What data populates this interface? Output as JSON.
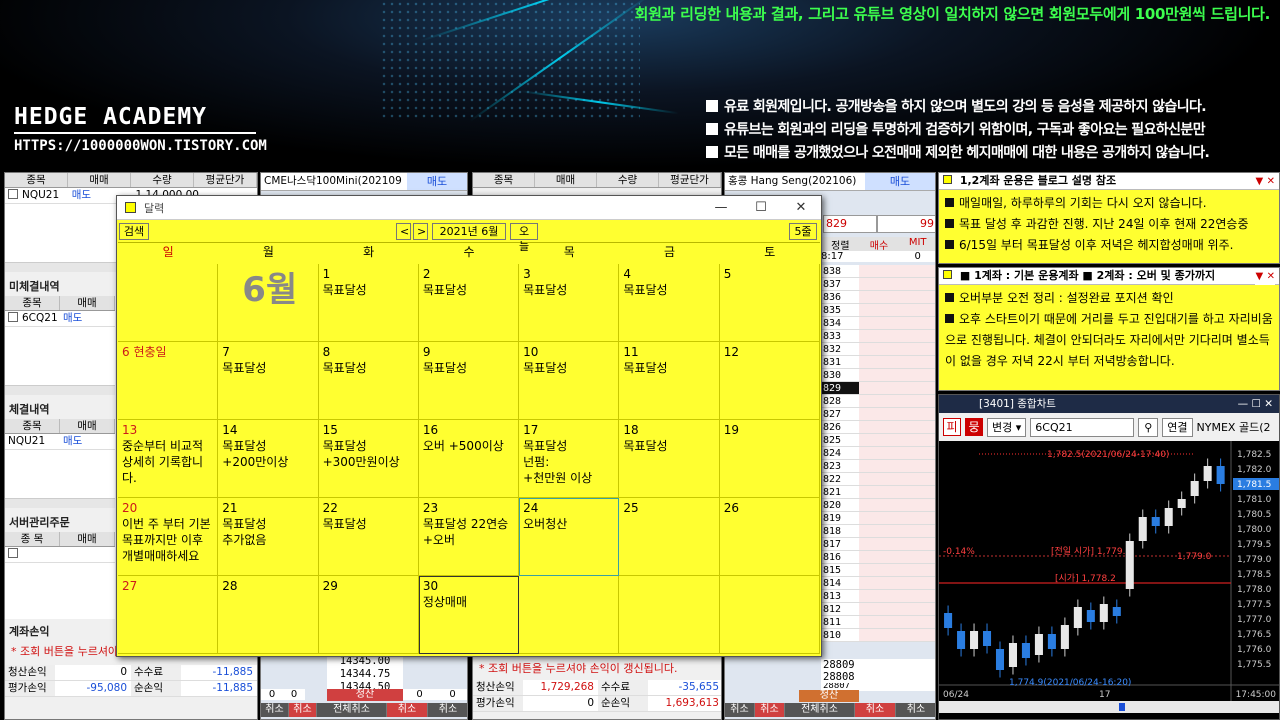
{
  "banner": {
    "top_notice": "회원과 리딩한 내용과 결과, 그리고 유튜브 영상이 일치하지 않으면 회원모두에게 100만원씩 드립니다.",
    "brand": "HEDGE ACADEMY",
    "brand_url": "HTTPS://1000000WON.TISTORY.COM",
    "bullets": [
      "유료 회원제입니다. 공개방송을 하지 않으며 별도의 강의 등 음성을 제공하지 않습니다.",
      "유튜브는 회원과의 리딩을 투명하게 검증하기 위함이며, 구독과 좋아요는 필요하신분만",
      "모든 매매를 공개했었으나 오전매매 제외한 헤지매매에 대한 내용은 공개하지 않습니다."
    ]
  },
  "left_panel": {
    "headers": [
      "종목",
      "매매",
      "수량",
      "평균단가"
    ],
    "row1": {
      "symbol": "NQU21",
      "side": "매도",
      "rest": "1  14,000.00"
    },
    "unfilled_title": "미체결내역",
    "unfilled_headers": [
      "종목",
      "매매"
    ],
    "unfilled_row": {
      "symbol": "6CQ21",
      "side": "매도"
    },
    "filled_title": "체결내역",
    "filled_headers": [
      "종목",
      "매매"
    ],
    "filled_row": {
      "symbol": "NQU21",
      "side": "매도"
    },
    "server_title": "서버관리주문",
    "server_headers": [
      "종 목",
      "매매"
    ],
    "account_title": "계좌손익",
    "account_note": "* 조회 버튼을 누르셔야 손익이 갱신됩니다.",
    "pnl_rows": [
      {
        "label": "청산손익",
        "value": "0",
        "label2": "수수료",
        "value2": "-11,885"
      },
      {
        "label": "평가손익",
        "value": "-95,080",
        "label2": "순손익",
        "value2": "-11,885"
      }
    ]
  },
  "mid_panel": {
    "title": "CME나스닥100Mini(202109",
    "side_label": "매도",
    "prices": [
      "14345.00",
      "14344.75",
      "14344.50"
    ],
    "clear_label": "청산",
    "buttons": [
      "취소",
      "취소",
      "전체취소",
      "취소",
      "취소"
    ],
    "zeros": [
      "0",
      "0",
      "0",
      "0"
    ]
  },
  "right_mid_panel": {
    "headers": [
      "종목",
      "매매",
      "수량",
      "평균단가"
    ],
    "account_note": "* 조회 버튼을 누르셔야 손익이 갱신됩니다.",
    "pnl_rows": [
      {
        "label": "청산손익",
        "value": "1,729,268",
        "label2": "수수료",
        "value2": "-35,655"
      },
      {
        "label": "평가손익",
        "value": "0",
        "label2": "순손익",
        "value2": "1,693,613"
      }
    ]
  },
  "hangseng_panel": {
    "title": "홍콩 Hang Seng(202106)",
    "side_label": "매도",
    "price_box": "829",
    "qty_box": "99",
    "cols": [
      "정렬",
      "매수",
      "MIT"
    ],
    "time": "8:17",
    "zero": "0",
    "ladder": [
      "838",
      "837",
      "836",
      "835",
      "834",
      "833",
      "832",
      "831",
      "830",
      "829",
      "828",
      "827",
      "826",
      "825",
      "824",
      "823",
      "822",
      "821",
      "820",
      "819",
      "818",
      "817",
      "816",
      "815",
      "814",
      "813",
      "812",
      "811",
      "810"
    ],
    "bottom_prices": [
      "28809",
      "28808",
      "28807"
    ],
    "clear_label": "청산",
    "buttons": [
      "취소",
      "취소",
      "전체취소",
      "취소",
      "취소"
    ]
  },
  "calendar": {
    "title": "달력",
    "search_label": "검색",
    "prev": "<",
    "next": ">",
    "month_label": "2021년 6월",
    "today_label": "오늘",
    "week_label": "5줄",
    "dow": [
      "일",
      "월",
      "화",
      "수",
      "목",
      "금",
      "토"
    ],
    "month_big": "6월",
    "cells": [
      {
        "d": "",
        "n": ""
      },
      {
        "d": "",
        "n": ""
      },
      {
        "d": "1",
        "n": "목표달성"
      },
      {
        "d": "2",
        "n": "목표달성"
      },
      {
        "d": "3",
        "n": "목표달성"
      },
      {
        "d": "4",
        "n": "목표달성"
      },
      {
        "d": "5",
        "n": ""
      },
      {
        "d": "6 현충일",
        "n": ""
      },
      {
        "d": "7",
        "n": "목표달성"
      },
      {
        "d": "8",
        "n": "목표달성"
      },
      {
        "d": "9",
        "n": "목표달성"
      },
      {
        "d": "10",
        "n": "목표달성"
      },
      {
        "d": "11",
        "n": "목표달성"
      },
      {
        "d": "12",
        "n": ""
      },
      {
        "d": "13",
        "n": "중순부터 비교적\n상세히 기록합니\n다."
      },
      {
        "d": "14",
        "n": "목표달성\n+200만이상"
      },
      {
        "d": "15",
        "n": "목표달성\n+300만원이상"
      },
      {
        "d": "16",
        "n": "오버 +500이상"
      },
      {
        "d": "17",
        "n": "목표달성\n넌펌:\n+천만원 이상"
      },
      {
        "d": "18",
        "n": "목표달성"
      },
      {
        "d": "19",
        "n": ""
      },
      {
        "d": "20",
        "n": "이번 주 부터 기본\n목표까지만 이후\n개별매매하세요"
      },
      {
        "d": "21",
        "n": "목표달성\n추가없음"
      },
      {
        "d": "22",
        "n": "목표달성"
      },
      {
        "d": "23",
        "n": "목표달성 22연승\n+오버"
      },
      {
        "d": "24",
        "n": "오버청산"
      },
      {
        "d": "25",
        "n": ""
      },
      {
        "d": "26",
        "n": ""
      },
      {
        "d": "27",
        "n": ""
      },
      {
        "d": "28",
        "n": ""
      },
      {
        "d": "29",
        "n": ""
      },
      {
        "d": "30",
        "n": "정상매매"
      },
      {
        "d": "",
        "n": ""
      },
      {
        "d": "",
        "n": ""
      },
      {
        "d": "",
        "n": ""
      }
    ]
  },
  "note1": {
    "title": "1,2계좌 운용은 블로그 설명 참조",
    "items": [
      "매일매일, 하루하루의 기회는 다시 오지 않습니다.",
      "목표 달성 후 과감한 진행. 지난 24일 이후 현재 22연승중",
      "6/15일 부터 목표달성 이후 저녁은 헤지합성매매 위주."
    ]
  },
  "note2": {
    "title": "■ 1계좌 : 기본 운용계좌 ■ 2계좌 : 오버 및 종가까지",
    "items": [
      "오버부분 오전 정리 : 설정완료 포지션 확인",
      "오후 스타트이기 때문에 거리를 두고 진입대기를 하고 자리비움으로 진행됩니다. 체결이 안되더라도 자리에서만 기다리며 별소득이 없을 경우 저녁 22시 부터 저녁방송합니다."
    ]
  },
  "chart": {
    "window_title": "[3401] 종합차트",
    "tb_buttons": [
      "피",
      "뭉"
    ],
    "change_label": "변경",
    "symbol": "6CQ21",
    "link_label": "연결",
    "product": "NYMEX 골드(2",
    "high_label": "1,782.5(2021/06/24-17:40)",
    "prev_open_label": "[전일 시가] 1,779.1",
    "prev_open_right": "1,779.0",
    "open_label": "[시가] 1,778.2",
    "change_pct": "-0.14%",
    "low_label": "1,774.9(2021/06/24-16:20)",
    "last_price": "1,781.5",
    "y_ticks": [
      "1,782.5",
      "1,782.0",
      "1,781.5",
      "1,781.0",
      "1,780.5",
      "1,780.0",
      "1,779.5",
      "1,779.0",
      "1,778.5",
      "1,778.0",
      "1,777.5",
      "1,777.0",
      "1,776.5",
      "1,776.0",
      "1,775.5"
    ],
    "x_labels": [
      "06/24",
      "17",
      "17:45:00"
    ],
    "colors": {
      "up": "#e8e8e8",
      "down": "#2a7de1",
      "accent": "#ff2020"
    }
  },
  "chart_data": {
    "type": "candlestick",
    "title": "NYMEX 골드",
    "x": [
      "16:00",
      "16:05",
      "16:10",
      "16:15",
      "16:20",
      "16:25",
      "16:30",
      "16:35",
      "16:40",
      "16:45",
      "16:50",
      "16:55",
      "17:00",
      "17:05",
      "17:10",
      "17:15",
      "17:20",
      "17:25",
      "17:30",
      "17:35",
      "17:40",
      "17:45"
    ],
    "open": [
      1777.2,
      1776.6,
      1776.0,
      1776.6,
      1776.0,
      1775.4,
      1776.2,
      1775.8,
      1776.5,
      1776.0,
      1776.7,
      1777.3,
      1776.9,
      1777.4,
      1778.0,
      1779.6,
      1780.4,
      1780.1,
      1780.7,
      1781.1,
      1781.6,
      1782.1
    ],
    "close": [
      1776.7,
      1776.0,
      1776.6,
      1776.1,
      1775.3,
      1776.2,
      1775.7,
      1776.5,
      1776.0,
      1776.8,
      1777.4,
      1776.9,
      1777.5,
      1777.1,
      1779.6,
      1780.4,
      1780.1,
      1780.7,
      1781.0,
      1781.6,
      1782.1,
      1781.5
    ],
    "ylim": [
      1774.8,
      1782.8
    ]
  }
}
